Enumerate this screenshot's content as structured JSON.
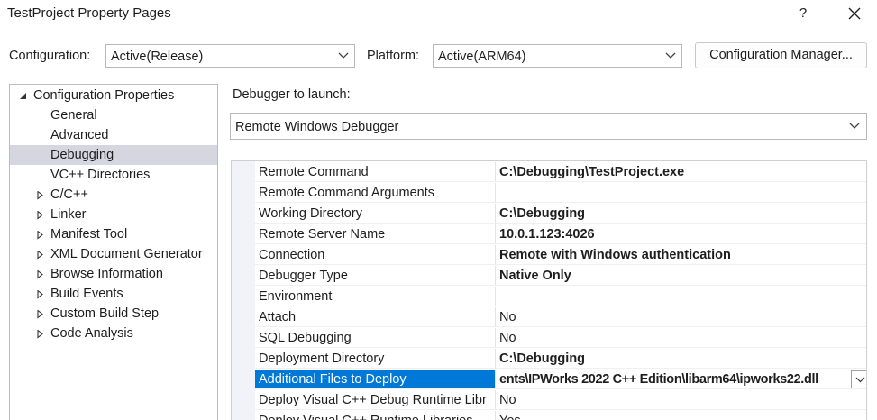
{
  "window": {
    "title": "TestProject Property Pages",
    "help": "?"
  },
  "config_row": {
    "configuration_label": "Configuration:",
    "configuration_value": "Active(Release)",
    "platform_label": "Platform:",
    "platform_value": "Active(ARM64)",
    "config_manager_button": "Configuration Manager..."
  },
  "tree": {
    "items": [
      {
        "label": "Configuration Properties",
        "expander": "expanded",
        "level": 0,
        "selected": false
      },
      {
        "label": "General",
        "expander": "none",
        "level": 1,
        "selected": false
      },
      {
        "label": "Advanced",
        "expander": "none",
        "level": 1,
        "selected": false
      },
      {
        "label": "Debugging",
        "expander": "none",
        "level": 1,
        "selected": true
      },
      {
        "label": "VC++ Directories",
        "expander": "none",
        "level": 1,
        "selected": false
      },
      {
        "label": "C/C++",
        "expander": "collapsed",
        "level": 1,
        "selected": false
      },
      {
        "label": "Linker",
        "expander": "collapsed",
        "level": 1,
        "selected": false
      },
      {
        "label": "Manifest Tool",
        "expander": "collapsed",
        "level": 1,
        "selected": false
      },
      {
        "label": "XML Document Generator",
        "expander": "collapsed",
        "level": 1,
        "selected": false
      },
      {
        "label": "Browse Information",
        "expander": "collapsed",
        "level": 1,
        "selected": false
      },
      {
        "label": "Build Events",
        "expander": "collapsed",
        "level": 1,
        "selected": false
      },
      {
        "label": "Custom Build Step",
        "expander": "collapsed",
        "level": 1,
        "selected": false
      },
      {
        "label": "Code Analysis",
        "expander": "collapsed",
        "level": 1,
        "selected": false
      }
    ]
  },
  "debugger": {
    "label": "Debugger to launch:",
    "value": "Remote Windows Debugger"
  },
  "properties": [
    {
      "name": "Remote Command",
      "value": "C:\\Debugging\\TestProject.exe",
      "bold": true
    },
    {
      "name": "Remote Command Arguments",
      "value": "",
      "bold": false
    },
    {
      "name": "Working Directory",
      "value": "C:\\Debugging",
      "bold": true
    },
    {
      "name": "Remote Server Name",
      "value": "10.0.1.123:4026",
      "bold": true
    },
    {
      "name": "Connection",
      "value": "Remote with Windows authentication",
      "bold": true
    },
    {
      "name": "Debugger Type",
      "value": "Native Only",
      "bold": true
    },
    {
      "name": "Environment",
      "value": "",
      "bold": false
    },
    {
      "name": "Attach",
      "value": "No",
      "bold": false
    },
    {
      "name": "SQL Debugging",
      "value": "No",
      "bold": false
    },
    {
      "name": "Deployment Directory",
      "value": "C:\\Debugging",
      "bold": true
    },
    {
      "name": "Additional Files to Deploy",
      "value": "ents\\IPWorks 2022 C++ Edition\\libarm64\\ipworks22.dll",
      "bold": true,
      "selected": true,
      "has_dropdown": true
    },
    {
      "name": "Deploy Visual C++ Debug Runtime Libr",
      "value": "No",
      "bold": false
    },
    {
      "name": "Deploy Visual C++ Runtime Libraries",
      "value": "Yes",
      "bold": false
    }
  ],
  "colors": {
    "selection_blue": "#0078d7",
    "tree_selection": "#d6d6e0",
    "gutter": "#f1f3f8"
  }
}
